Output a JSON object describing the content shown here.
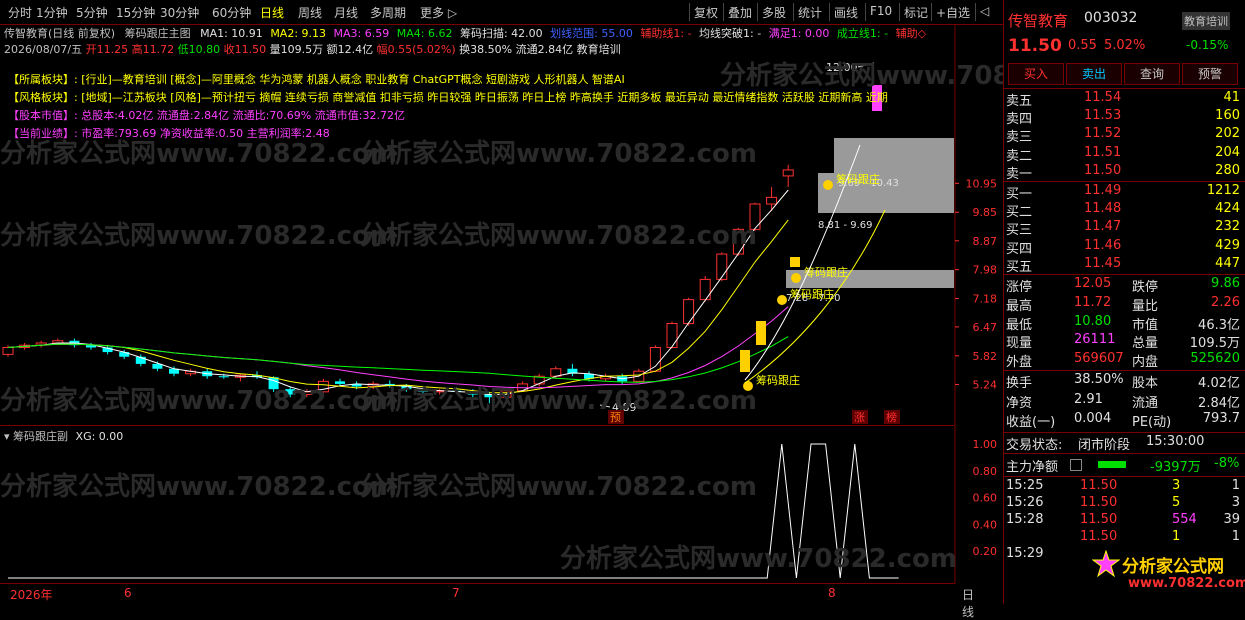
{
  "toolbar": {
    "periods": [
      "分时",
      "1分钟",
      "5分钟",
      "15分钟",
      "30分钟",
      "60分钟",
      "日线",
      "周线",
      "月线",
      "多周期",
      "更多 ▷"
    ],
    "active_period": "日线",
    "actions": [
      "复权",
      "叠加",
      "多股",
      "统计",
      "画线",
      "F10",
      "标记",
      "+自选",
      "◁"
    ]
  },
  "stock": {
    "name": "传智教育",
    "code": "003032",
    "industry_badge": "教育培训",
    "price": "11.50",
    "change": "0.55",
    "change_pct": "5.02%",
    "industry_change": "-0.15%"
  },
  "main_chart": {
    "title": "传智教育(日线 前复权)",
    "indicator_name": "筹码跟庄主图",
    "ma": [
      "MA1: 10.91",
      "MA2: 9.13",
      "MA3: 6.59",
      "MA4: 6.62"
    ],
    "extra": [
      "筹码扫描: 42.00",
      "划线范围: 55.00",
      "辅助线1: -",
      "均线突破1: -",
      "满足1: 0.00",
      "成立线1: -",
      "辅助◇"
    ],
    "ohlc": {
      "date": "2026/08/07/五",
      "open": "开11.25",
      "high": "高11.72",
      "low": "低10.80",
      "close": "收11.50",
      "volume": "量109.5万",
      "amount": "额12.4亿",
      "amp": "幅0.55(5.02%)",
      "turnover": "换38.50%",
      "float": "流通2.84亿",
      "industry": "教育培训"
    },
    "info_lines": [
      {
        "label": "【所属板块】:",
        "text": "[行业]—教育培训 [概念]—阿里概念 华为鸿蒙 机器人概念 职业教育 ChatGPT概念 短剧游戏 人形机器人 智谱AI"
      },
      {
        "label": "【风格板块】:",
        "text": "[地域]—江苏板块 [风格]—预计扭亏 摘帽 连续亏损 商誉减值 扣非亏损 昨日较强 昨日振荡 昨日上榜 昨高换手 近期多板 最近异动 最近情绪指数 活跃股 近期新高 近期"
      },
      {
        "label": "【股本市值】:",
        "text": "总股本:4.02亿 流通盘:2.84亿 流通比:70.69% 流通市值:32.72亿"
      },
      {
        "label": "【当前业绩】:",
        "text": "市盈率:793.69 净资收益率:0.50 主营利润率:2.48"
      }
    ],
    "price_ticks": [
      "10.95",
      "9.85",
      "8.87",
      "7.98",
      "7.18",
      "6.47",
      "5.82",
      "5.24"
    ],
    "annotations": {
      "high_label": "12.00",
      "low_label": "4.89",
      "zone1": "9.69 - 10.43",
      "zone2": "8.81 - 9.69",
      "zone3": "7.28 - 7.70",
      "chip_tag": "筹码跟庄",
      "tag_zhang": "涨",
      "tag_bang": "榜",
      "tag_yu": "预"
    },
    "watermark": "分析家公式网www.70822.com"
  },
  "sub_chart": {
    "title": "筹码跟庄副",
    "xg": "XG: 0.00",
    "ticks": [
      "1.00",
      "0.80",
      "0.60",
      "0.40",
      "0.20"
    ]
  },
  "date_axis": {
    "labels": [
      "2026年",
      "6",
      "7",
      "8"
    ],
    "period": "日线"
  },
  "quotes": {
    "sell": [
      {
        "label": "卖五",
        "price": "11.54",
        "vol": "41"
      },
      {
        "label": "卖四",
        "price": "11.53",
        "vol": "160"
      },
      {
        "label": "卖三",
        "price": "11.52",
        "vol": "202"
      },
      {
        "label": "卖二",
        "price": "11.51",
        "vol": "204"
      },
      {
        "label": "卖一",
        "price": "11.50",
        "vol": "280"
      }
    ],
    "buy": [
      {
        "label": "买一",
        "price": "11.49",
        "vol": "1212"
      },
      {
        "label": "买二",
        "price": "11.48",
        "vol": "424"
      },
      {
        "label": "买三",
        "price": "11.47",
        "vol": "232"
      },
      {
        "label": "买四",
        "price": "11.46",
        "vol": "429"
      },
      {
        "label": "买五",
        "price": "11.45",
        "vol": "447"
      }
    ]
  },
  "buttons": [
    "买入",
    "卖出",
    "查询",
    "预警"
  ],
  "stats": [
    {
      "l1": "涨停",
      "v1": "12.05",
      "c1": "red",
      "l2": "跌停",
      "v2": "9.86",
      "c2": "green"
    },
    {
      "l1": "最高",
      "v1": "11.72",
      "c1": "red",
      "l2": "量比",
      "v2": "2.26",
      "c2": "red"
    },
    {
      "l1": "最低",
      "v1": "10.80",
      "c1": "green",
      "l2": "市值",
      "v2": "46.3亿",
      "c2": "white"
    },
    {
      "l1": "现量",
      "v1": "26111",
      "c1": "magenta",
      "l2": "总量",
      "v2": "109.5万",
      "c2": "white"
    },
    {
      "l1": "外盘",
      "v1": "569607",
      "c1": "red",
      "l2": "内盘",
      "v2": "525620",
      "c2": "green"
    }
  ],
  "stats2": [
    {
      "l1": "换手",
      "v1": "38.50%",
      "l2": "股本",
      "v2": "4.02亿"
    },
    {
      "l1": "净资",
      "v1": "2.91",
      "l2": "流通",
      "v2": "2.84亿"
    },
    {
      "l1": "收益(一)",
      "v1": "0.004",
      "l2": "PE(动)",
      "v2": "793.7"
    }
  ],
  "trade_status": {
    "label": "交易状态:",
    "value": "闭市阶段",
    "time": "15:30:00"
  },
  "main_flow": {
    "label": "主力净额",
    "value": "-9397万",
    "pct": "-8%"
  },
  "ticks": [
    {
      "time": "15:25",
      "price": "11.50",
      "vol": "3",
      "n": "1",
      "vc": "yellow"
    },
    {
      "time": "15:26",
      "price": "11.50",
      "vol": "5",
      "n": "3",
      "vc": "yellow"
    },
    {
      "time": "15:28",
      "price": "11.50",
      "vol": "554",
      "n": "39",
      "vc": "magenta"
    },
    {
      "time": "",
      "price": "11.50",
      "vol": "1",
      "n": "1",
      "vc": "yellow"
    },
    {
      "time": "15:29",
      "price": "",
      "vol": "",
      "n": "",
      "vc": "yellow"
    }
  ],
  "logo": {
    "text": "分析家公式网",
    "url": "www.70822.com"
  },
  "colors": {
    "up": "#ff3030",
    "down": "#00ffff",
    "ma1": "#ffffff",
    "ma2": "#ffff00",
    "ma3": "#ff40ff",
    "ma4": "#00ff00",
    "frame": "#7a0000"
  },
  "candles": [
    [
      10,
      5.85,
      6.05,
      5.8,
      6.0
    ],
    [
      11,
      6.0,
      6.1,
      5.95,
      6.05
    ],
    [
      12,
      6.05,
      6.15,
      6.0,
      6.1
    ],
    [
      13,
      6.1,
      6.2,
      6.05,
      6.15
    ],
    [
      14,
      6.15,
      6.2,
      6.0,
      6.05
    ],
    [
      15,
      6.05,
      6.1,
      5.95,
      6.0
    ],
    [
      16,
      6.0,
      6.05,
      5.85,
      5.9
    ],
    [
      17,
      5.9,
      5.95,
      5.75,
      5.8
    ],
    [
      18,
      5.8,
      5.85,
      5.6,
      5.65
    ],
    [
      19,
      5.65,
      5.7,
      5.5,
      5.55
    ],
    [
      20,
      5.55,
      5.6,
      5.4,
      5.45
    ],
    [
      21,
      5.45,
      5.55,
      5.4,
      5.5
    ],
    [
      22,
      5.5,
      5.55,
      5.35,
      5.4
    ],
    [
      23,
      5.4,
      5.45,
      5.35,
      5.38
    ],
    [
      24,
      5.38,
      5.45,
      5.3,
      5.42
    ],
    [
      25,
      5.42,
      5.5,
      5.35,
      5.38
    ],
    [
      26,
      5.38,
      5.4,
      5.1,
      5.15
    ],
    [
      27,
      5.15,
      5.2,
      5.0,
      5.05
    ],
    [
      28,
      5.05,
      5.15,
      5.0,
      5.1
    ],
    [
      29,
      5.1,
      5.35,
      5.05,
      5.3
    ],
    [
      30,
      5.3,
      5.35,
      5.2,
      5.25
    ],
    [
      31,
      5.25,
      5.3,
      5.15,
      5.2
    ],
    [
      32,
      5.2,
      5.3,
      5.15,
      5.25
    ],
    [
      33,
      5.25,
      5.32,
      5.18,
      5.22
    ],
    [
      34,
      5.22,
      5.25,
      5.1,
      5.15
    ],
    [
      35,
      5.15,
      5.2,
      5.05,
      5.1
    ],
    [
      36,
      5.1,
      5.15,
      5.05,
      5.12
    ],
    [
      37,
      5.12,
      5.18,
      5.08,
      5.1
    ],
    [
      38,
      5.1,
      5.15,
      5.0,
      5.05
    ],
    [
      39,
      5.05,
      5.1,
      4.89,
      5.0
    ],
    [
      40,
      5.0,
      5.15,
      4.98,
      5.12
    ],
    [
      41,
      5.12,
      5.3,
      5.1,
      5.25
    ],
    [
      42,
      5.25,
      5.45,
      5.2,
      5.4
    ],
    [
      43,
      5.4,
      5.6,
      5.35,
      5.55
    ],
    [
      44,
      5.55,
      5.65,
      5.4,
      5.45
    ],
    [
      45,
      5.45,
      5.5,
      5.3,
      5.35
    ],
    [
      46,
      5.35,
      5.45,
      5.3,
      5.4
    ],
    [
      47,
      5.4,
      5.45,
      5.25,
      5.3
    ],
    [
      48,
      5.3,
      5.55,
      5.28,
      5.5
    ],
    [
      49,
      5.5,
      6.05,
      5.48,
      6.0
    ],
    [
      50,
      6.0,
      6.6,
      5.98,
      6.55
    ],
    [
      51,
      6.55,
      7.2,
      6.5,
      7.15
    ],
    [
      52,
      7.15,
      7.8,
      7.1,
      7.7
    ],
    [
      53,
      7.7,
      8.5,
      7.65,
      8.45
    ],
    [
      54,
      8.45,
      9.3,
      8.4,
      9.25
    ],
    [
      55,
      9.25,
      10.2,
      9.2,
      10.15
    ],
    [
      56,
      10.15,
      10.8,
      9.9,
      10.4
    ],
    [
      57,
      11.25,
      11.72,
      10.8,
      11.5
    ]
  ],
  "sub_signal": [
    0,
    0,
    0,
    0,
    0,
    0,
    0,
    0,
    0,
    0,
    0,
    0,
    0,
    0,
    0,
    0,
    0,
    0,
    0,
    0,
    0,
    0,
    0,
    0,
    0,
    0,
    0,
    0,
    0,
    0,
    0,
    0,
    0,
    0,
    0,
    0,
    0,
    0,
    0,
    0,
    0,
    0,
    0,
    0,
    0,
    0,
    0,
    0,
    0,
    0,
    0,
    0,
    0,
    1,
    0,
    1,
    1,
    0,
    1,
    0,
    0,
    0
  ]
}
